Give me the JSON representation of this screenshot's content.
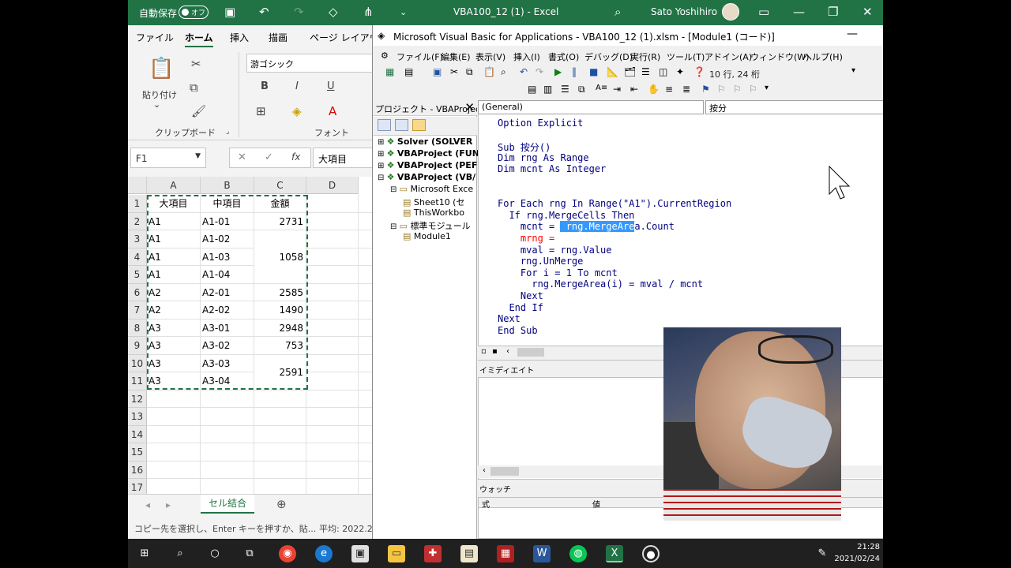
{
  "excel": {
    "autosave_label": "自動保存",
    "autosave_state": "オフ",
    "title": "VBA100_12 (1)  -  Excel",
    "user": "Sato Yoshihiro",
    "ribbon_tabs": [
      "ファイル",
      "ホーム",
      "挿入",
      "描画",
      "ページ レイアウト"
    ],
    "paste_label": "貼り付け",
    "clipboard_label": "クリップボード",
    "font_label": "フォント",
    "font_name": "游ゴシック",
    "bold": "B",
    "italic": "I",
    "underline": "U",
    "name_box": "F1",
    "formula_fx": "fx",
    "formula_value": "大項目",
    "columns": [
      "A",
      "B",
      "C",
      "D"
    ],
    "rows": [
      [
        "大項目",
        "中項目",
        "金額"
      ],
      [
        "A1",
        "A1-01",
        "2731"
      ],
      [
        "A1",
        "A1-02",
        ""
      ],
      [
        "A1",
        "A1-03",
        "1058"
      ],
      [
        "A1",
        "A1-04",
        ""
      ],
      [
        "A2",
        "A2-01",
        "2585"
      ],
      [
        "A2",
        "A2-02",
        "1490"
      ],
      [
        "A3",
        "A3-01",
        "2948"
      ],
      [
        "A3",
        "A3-02",
        "753"
      ],
      [
        "A3",
        "A3-03",
        "2591"
      ],
      [
        "A3",
        "A3-04",
        ""
      ]
    ],
    "row_numbers": [
      "1",
      "2",
      "3",
      "4",
      "5",
      "6",
      "7",
      "8",
      "9",
      "10",
      "11",
      "12",
      "13",
      "14",
      "15",
      "16",
      "17"
    ],
    "sheet_tab": "セル結合",
    "status_text": "コピー先を選択し、Enter キーを押すか、貼...",
    "status_avg": "平均: 2022.2"
  },
  "vbe": {
    "title": "Microsoft Visual Basic for Applications - VBA100_12 (1).xlsm - [Module1 (コード)]",
    "menu": [
      "ファイル(F)",
      "編集(E)",
      "表示(V)",
      "挿入(I)",
      "書式(O)",
      "デバッグ(D)",
      "実行(R)",
      "ツール(T)",
      "アドイン(A)",
      "ウィンドウ(W)",
      "ヘルプ(H)"
    ],
    "position": "10 行, 24 桁",
    "project_title": "プロジェクト - VBAProject",
    "tree": [
      "Solver (SOLVER",
      "VBAProject (FUN",
      "VBAProject (PEF",
      "VBAProject (VB/",
      "Microsoft Exce",
      "Sheet10 (セ",
      "ThisWorkbo",
      "標準モジュール",
      "Module1"
    ],
    "combo_left": "(General)",
    "combo_right": "按分",
    "code": [
      "Option Explicit",
      "",
      "Sub 按分()",
      "Dim rng As Range",
      "Dim mcnt As Integer",
      "",
      "",
      "For Each rng In Range(\"A1\").CurrentRegion",
      "  If rng.MergeCells Then",
      "    mcnt = ",
      "    mrng = ",
      "    mval = rng.Value",
      "    rng.UnMerge",
      "    For i = 1 To mcnt",
      "      rng.MergeArea(i) = mval / mcnt",
      "    Next",
      "  End If",
      "Next",
      "End Sub"
    ],
    "code_line10_selected": " rng.MergeAre",
    "code_line10_rest": "a.Count",
    "immediate_title": "イミディエイト",
    "watch_title": "ウォッチ",
    "watch_col1": "式",
    "watch_col2": "値"
  },
  "taskbar": {
    "time": "21:28",
    "date": "2021/02/24"
  },
  "colors": {
    "excel_green": "#217346",
    "code_keyword": "#00007f",
    "selection": "#3399ff",
    "error_red": "#ff0000"
  }
}
